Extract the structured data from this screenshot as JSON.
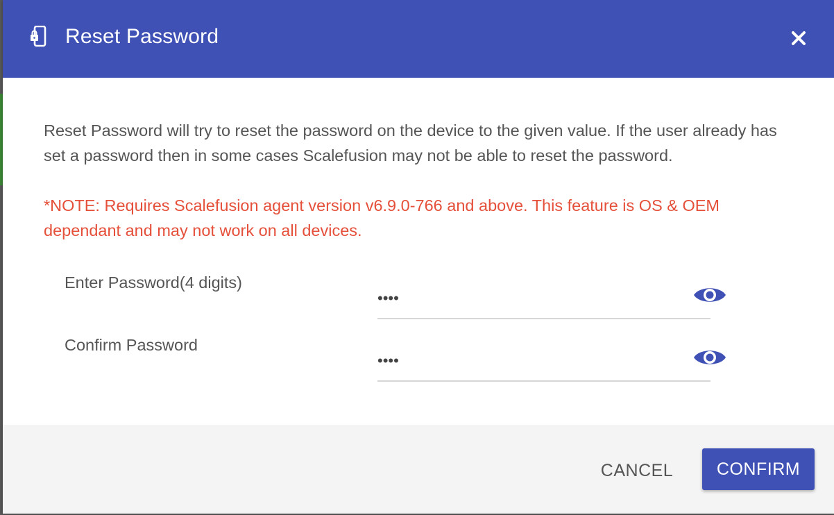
{
  "dialog": {
    "title": "Reset Password",
    "title_icon": "phone-lock-icon",
    "close_icon": "close-icon",
    "header_color": "#3f51b5",
    "description": "Reset Password will try to reset the password on the device to the given value. If the user already has set a password then in some cases Scalefusion may not be able to reset the password.",
    "note": "*NOTE: Requires Scalefusion agent version v6.9.0-766 and above. This feature is OS & OEM dependant and may not work on all devices.",
    "note_color": "#e5503a",
    "fields": [
      {
        "label": "Enter Password(4 digits)",
        "value": "••••",
        "icon": "eye-icon"
      },
      {
        "label": "Confirm Password",
        "value": "••••",
        "icon": "eye-icon"
      }
    ],
    "buttons": {
      "cancel_label": "CANCEL",
      "confirm_label": "CONFIRM"
    }
  }
}
